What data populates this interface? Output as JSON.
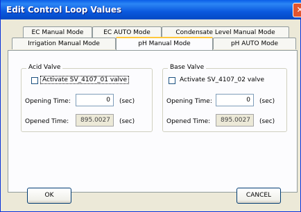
{
  "window": {
    "title": "Edit Control Loop Values"
  },
  "tabs": {
    "row1": [
      "EC Manual Mode",
      "EC AUTO Mode",
      "Condensate Level Manual Mode"
    ],
    "row2": [
      "Irrigation Manual Mode",
      "pH Manual Mode",
      "pH AUTO Mode"
    ],
    "active": "pH Manual Mode"
  },
  "acid": {
    "group_title": "Acid Valve",
    "checkbox_label": "Activate SV_4107_01 valve",
    "checked": false,
    "opening_time_label": "Opening Time:",
    "opening_time_value": "0",
    "opening_unit": "(sec)",
    "opened_time_label": "Opened Time:",
    "opened_time_value": "895.0027",
    "opened_unit": "(sec)"
  },
  "base": {
    "group_title": "Base Valve",
    "checkbox_label": "Activate SV_4107_02 valve",
    "checked": false,
    "opening_time_label": "Opening Time:",
    "opening_time_value": "0",
    "opening_unit": "(sec)",
    "opened_time_label": "Opened Time:",
    "opened_time_value": "895.0027",
    "opened_unit": "(sec)"
  },
  "buttons": {
    "ok": "OK",
    "cancel": "CANCEL"
  }
}
